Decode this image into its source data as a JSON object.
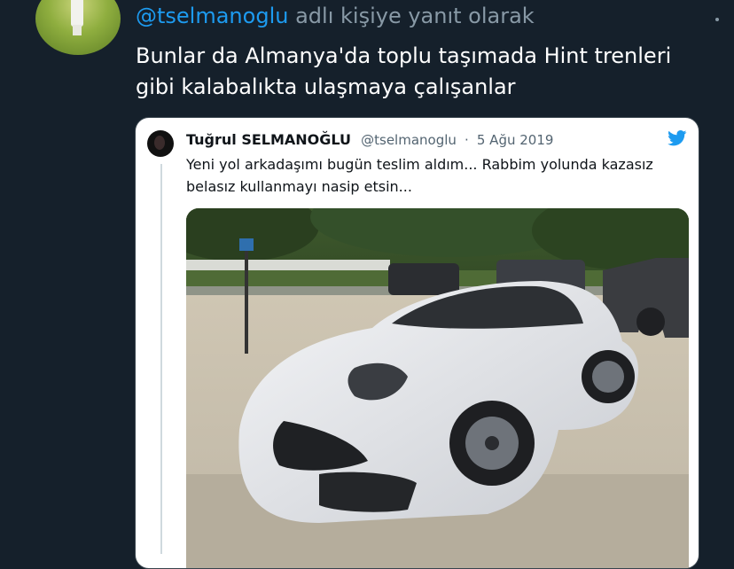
{
  "reply": {
    "prefix_mention": "@tselmanoglu",
    "suffix": "adlı kişiye yanıt olarak"
  },
  "tweet": {
    "text": "Bunlar da Almanya'da toplu taşımada Hint trenleri gibi kalabalıkta ulaşmaya çalışanlar"
  },
  "quote": {
    "name": "Tuğrul SELMANOĞLU",
    "handle": "@tselmanoglu",
    "separator": "·",
    "date": "5 Ağu 2019",
    "text": "Yeni yol arkadaşımı bugün teslim aldım... Rabbim yolunda kazasız belasız kullanmayı nasip etsin...",
    "image": "white-sports-car-photo"
  },
  "icons": {
    "menu": "more-icon",
    "brand": "twitter-bird-icon"
  },
  "colors": {
    "background": "#15202b",
    "accent": "#1d9bf0",
    "muted": "#8899a6"
  }
}
